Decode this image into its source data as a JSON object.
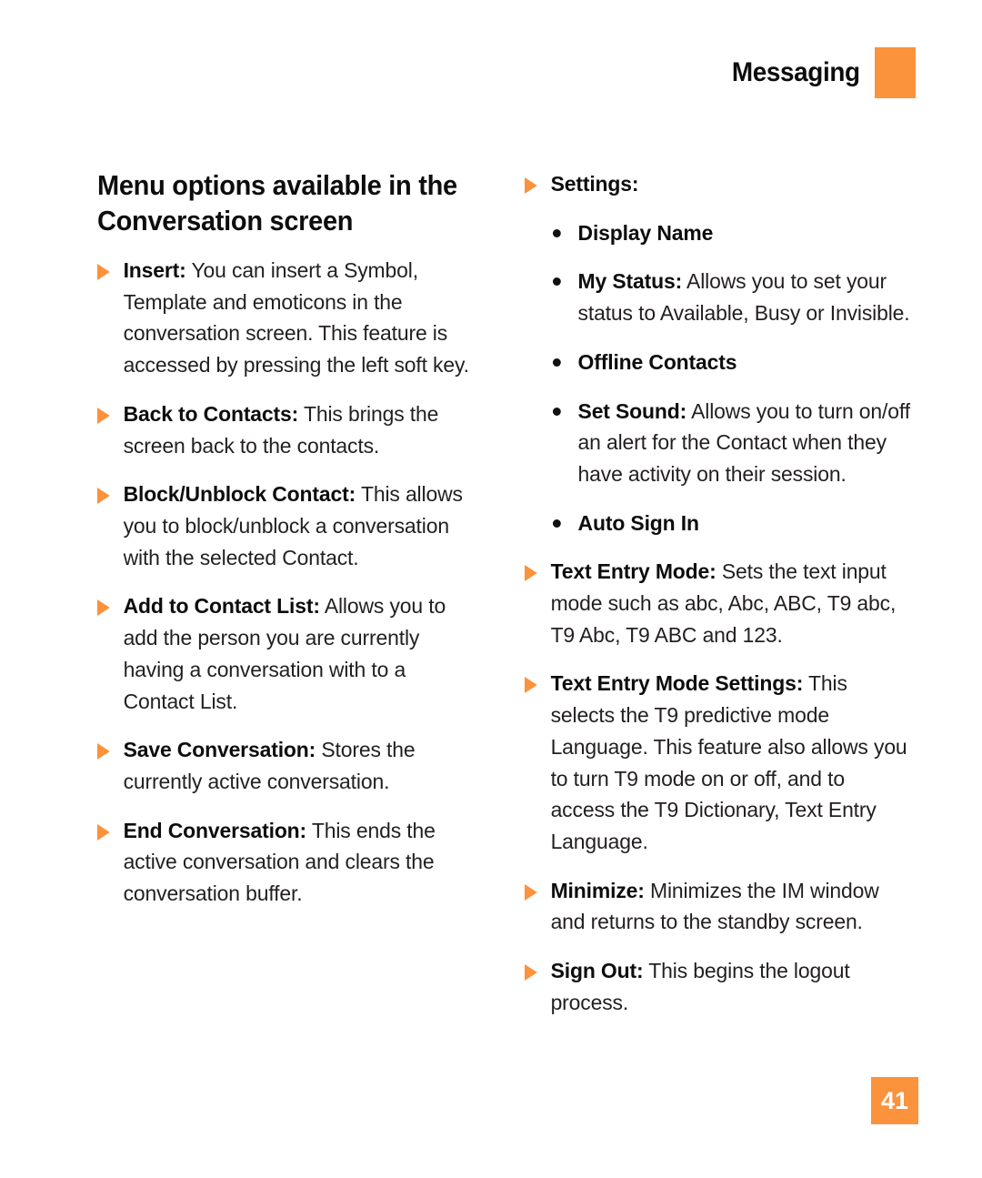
{
  "header": {
    "title": "Messaging",
    "tab_color": "#fb923c"
  },
  "section": {
    "title": "Menu options available in the Conversation screen"
  },
  "colors": {
    "accent": "#fb923c",
    "body_text": "#231f20",
    "heading_text": "#0d0d0d"
  },
  "left_column": [
    {
      "marker": "triangle-bullet",
      "label": "Insert:",
      "text": " You can insert a Symbol, Template and emoticons in the conversation screen. This feature is accessed by pressing the left soft key."
    },
    {
      "marker": "triangle-bullet",
      "label": "Back to Contacts:",
      "text": " This brings the screen back to the contacts."
    },
    {
      "marker": "triangle-bullet",
      "label": "Block/Unblock Contact:",
      "text": " This allows you to block/unblock a conversation with the selected Contact."
    },
    {
      "marker": "triangle-bullet",
      "label": "Add to Contact List:",
      "text": " Allows you to add the person you are currently having a conversation with to a Contact List."
    },
    {
      "marker": "triangle-bullet",
      "label": "Save Conversation:",
      "text": " Stores the currently active conversation."
    },
    {
      "marker": "triangle-bullet",
      "label": "End Conversation:",
      "text": " This ends the active conversation and clears the conversation buffer."
    }
  ],
  "right_column": [
    {
      "marker": "triangle-bullet",
      "level": "top",
      "label": "Settings:",
      "text": ""
    },
    {
      "marker": "dot-bullet",
      "level": "sub",
      "label": "Display Name",
      "text": ""
    },
    {
      "marker": "dot-bullet",
      "level": "sub",
      "label": "My Status:",
      "text": " Allows you to set your status to Available, Busy or Invisible."
    },
    {
      "marker": "dot-bullet",
      "level": "sub",
      "label": "Offline Contacts",
      "text": ""
    },
    {
      "marker": "dot-bullet",
      "level": "sub",
      "label": "Set Sound:",
      "text": " Allows you to turn on/off an alert for the Contact when they have activity on their session."
    },
    {
      "marker": "dot-bullet",
      "level": "sub",
      "label": "Auto Sign In",
      "text": ""
    },
    {
      "marker": "triangle-bullet",
      "level": "top",
      "label": "Text Entry Mode:",
      "text": " Sets the text input mode such as abc, Abc, ABC, T9 abc, T9 Abc, T9 ABC and 123."
    },
    {
      "marker": "triangle-bullet",
      "level": "top",
      "label": "Text Entry Mode Settings:",
      "text": " This selects the T9 predictive mode Language. This feature also allows you to turn T9 mode on or off, and to access the T9 Dictionary, Text Entry Language."
    },
    {
      "marker": "triangle-bullet",
      "level": "top",
      "label": "Minimize:",
      "text": " Minimizes the IM window and returns to the standby screen."
    },
    {
      "marker": "triangle-bullet",
      "level": "top",
      "label": "Sign Out:",
      "text": " This begins the logout process."
    }
  ],
  "footer": {
    "page_number": "41"
  }
}
